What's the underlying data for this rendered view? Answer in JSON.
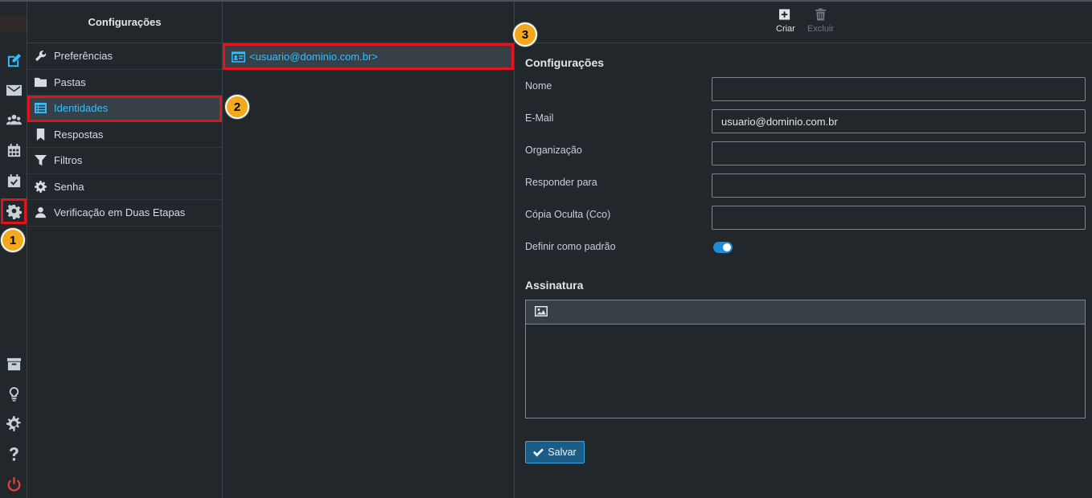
{
  "app": {
    "settings_title": "Configurações"
  },
  "rail": {
    "items": [
      {
        "name": "compose-icon"
      },
      {
        "name": "mail-icon"
      },
      {
        "name": "contacts-icon"
      },
      {
        "name": "calendar-icon"
      },
      {
        "name": "tasks-icon"
      },
      {
        "name": "settings-gear-icon"
      },
      {
        "name": "archive-icon"
      },
      {
        "name": "lightbulb-icon"
      },
      {
        "name": "cog-icon"
      },
      {
        "name": "help-icon"
      },
      {
        "name": "power-icon"
      }
    ]
  },
  "settings_menu": {
    "items": [
      {
        "label": "Preferências",
        "icon": "wrench-icon"
      },
      {
        "label": "Pastas",
        "icon": "folder-icon"
      },
      {
        "label": "Identidades",
        "icon": "list-icon",
        "selected": true
      },
      {
        "label": "Respostas",
        "icon": "bookmark-icon"
      },
      {
        "label": "Filtros",
        "icon": "filter-icon"
      },
      {
        "label": "Senha",
        "icon": "gear-icon"
      },
      {
        "label": "Verificação em Duas Etapas",
        "icon": "user-icon"
      }
    ]
  },
  "identities": {
    "items": [
      {
        "label": "<usuario@dominio.com.br>",
        "icon": "id-card-icon"
      }
    ]
  },
  "toolbar": {
    "create_label": "Criar",
    "delete_label": "Excluir"
  },
  "form": {
    "section_title": "Configurações",
    "fields": [
      {
        "label": "Nome",
        "value": ""
      },
      {
        "label": "E-Mail",
        "value": "usuario@dominio.com.br"
      },
      {
        "label": "Organização",
        "value": ""
      },
      {
        "label": "Responder para",
        "value": ""
      },
      {
        "label": "Cópia Oculta (Cco)",
        "value": ""
      }
    ],
    "default_label": "Definir como padrão",
    "default_enabled": true
  },
  "signature": {
    "title": "Assinatura",
    "value": ""
  },
  "save_label": "Salvar",
  "callouts": [
    "1",
    "2",
    "3"
  ],
  "colors": {
    "accent": "#37beff",
    "highlight": "#e0141a",
    "callout": "#f3a91b",
    "toggle": "#1f8dd6"
  }
}
